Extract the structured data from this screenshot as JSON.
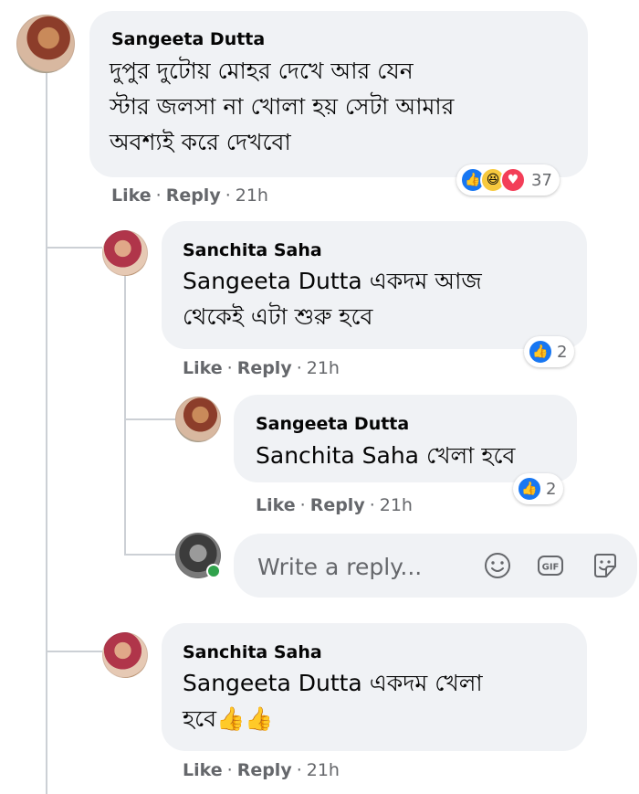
{
  "comments": [
    {
      "author": "Sangeeta Dutta",
      "text_lines": [
        "দুপুর দুটোয় মোহর দেখে আর যেন",
        "স্টার জলসা না খোলা হয় সেটা আমার",
        "অবশ্যই করে দেখবো"
      ],
      "reaction_count": "37",
      "reactions": [
        "like",
        "haha",
        "love"
      ],
      "like_label": "Like",
      "reply_label": "Reply",
      "time": "21h"
    },
    {
      "author": "Sanchita Saha",
      "mention": "Sangeeta Dutta",
      "text_line1_rest": "একদম আজ",
      "text_line2": "থেকেই এটা শুরু হবে",
      "reaction_count": "2",
      "like_label": "Like",
      "reply_label": "Reply",
      "time": "21h"
    },
    {
      "author": "Sangeeta Dutta",
      "mention": "Sanchita Saha",
      "text_rest": "খেলা হবে",
      "reaction_count": "2",
      "like_label": "Like",
      "reply_label": "Reply",
      "time": "21h"
    },
    {
      "author": "Sanchita Saha",
      "mention": "Sangeeta Dutta",
      "text_line1_rest": "একদম খেলা",
      "text_line2": "হবে👍👍",
      "like_label": "Like",
      "reply_label": "Reply",
      "time": "21h"
    }
  ],
  "reply_box": {
    "placeholder": "Write a reply...",
    "icons": [
      "emoji-icon",
      "gif-icon",
      "sticker-icon"
    ]
  },
  "colors": {
    "bubble": "#f0f2f5",
    "meta_text": "#65676b",
    "like_blue": "#1877f2",
    "online_green": "#31a24c"
  }
}
